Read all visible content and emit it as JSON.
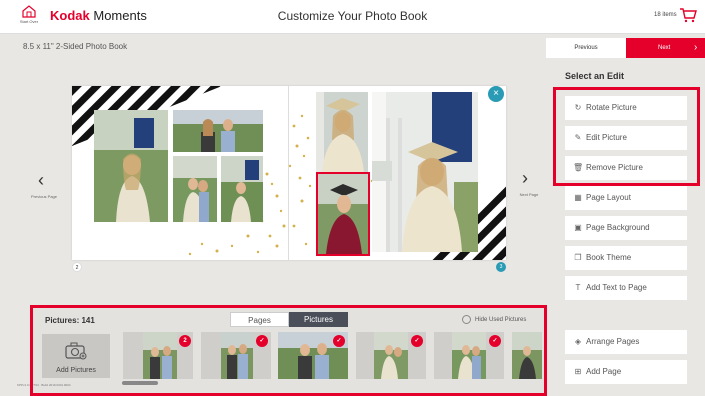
{
  "header": {
    "home_label": "Start Over",
    "brand_kodak": "Kodak",
    "brand_moments": "Moments",
    "title": "Customize Your Photo Book",
    "cart_count": "18 items"
  },
  "product_name": "8.5 x 11\" 2-Sided Photo Book",
  "nav": {
    "previous": "Previous",
    "next": "Next",
    "prev_page": "Previous Page",
    "next_page": "Next Page"
  },
  "edit_panel": {
    "heading": "Select an Edit",
    "items": [
      {
        "label": "Rotate Picture",
        "icon": "rotate-icon"
      },
      {
        "label": "Edit Picture",
        "icon": "edit-icon"
      },
      {
        "label": "Remove Picture",
        "icon": "trash-icon"
      },
      {
        "label": "Page Layout",
        "icon": "layout-icon"
      },
      {
        "label": "Page Background",
        "icon": "background-icon"
      },
      {
        "label": "Book Theme",
        "icon": "theme-icon"
      },
      {
        "label": "Add Text to Page",
        "icon": "text-icon"
      }
    ],
    "bottom_items": [
      {
        "label": "Arrange Pages",
        "icon": "layers-icon"
      },
      {
        "label": "Add Page",
        "icon": "add-page-icon"
      }
    ]
  },
  "spread": {
    "left_page_number": "2",
    "right_page_number": "3"
  },
  "tray": {
    "count_label": "Pictures: 141",
    "tab_pages": "Pages",
    "tab_pictures": "Pictures",
    "hide_used": "Hide Used Pictures",
    "add_pictures": "Add Pictures",
    "thumbs": [
      {
        "badge": "2"
      },
      {
        "badge": "✓"
      },
      {
        "badge": "✓"
      },
      {
        "badge": "✓"
      },
      {
        "badge": "✓"
      },
      {
        "badge": ""
      }
    ],
    "version": "KPPv1.0.0.7704 · Build 2019.0301.0004"
  },
  "colors": {
    "accent": "#e4002b",
    "teal": "#2a9bb5",
    "segment_dark": "#4a4f5a"
  }
}
